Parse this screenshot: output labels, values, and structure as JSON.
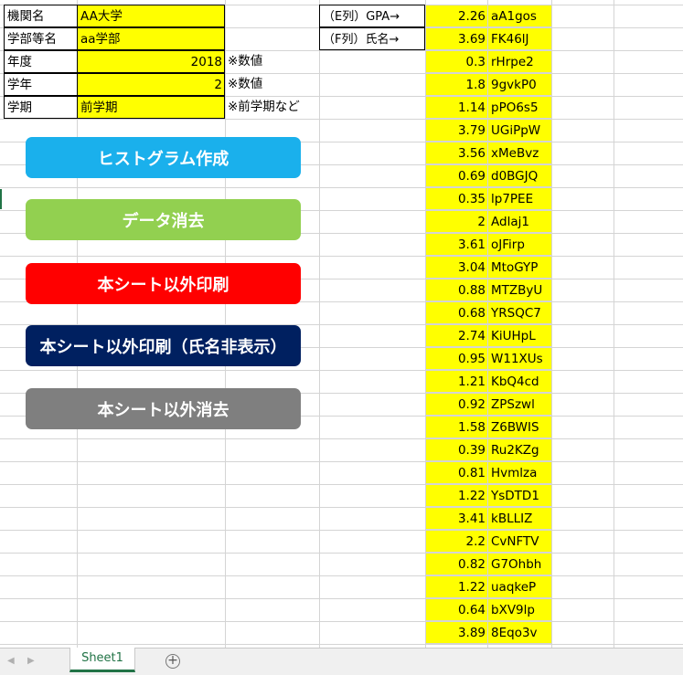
{
  "info": {
    "institution_label": "機関名",
    "institution_value": "AA大学",
    "faculty_label": "学部等名",
    "faculty_value": "aa学部",
    "year_label": "年度",
    "year_value": "2018",
    "year_note": "※数値",
    "grade_label": "学年",
    "grade_value": "2",
    "grade_note": "※数値",
    "term_label": "学期",
    "term_value": "前学期",
    "term_note": "※前学期など"
  },
  "column_hints": {
    "gpa_col": "（E列）GPA→",
    "name_col": "（F列）氏名→"
  },
  "buttons": {
    "histogram": {
      "label": "ヒストグラム作成",
      "color": "#1ab0ec"
    },
    "clear_data": {
      "label": "データ消去",
      "color": "#92d050"
    },
    "print_others": {
      "label": "本シート以外印刷",
      "color": "#ff0000"
    },
    "print_others_hidden": {
      "label": "本シート以外印刷（氏名非表示）",
      "color": "#002060"
    },
    "delete_others": {
      "label": "本シート以外消去",
      "color": "#7f7f7f"
    }
  },
  "gpa_rows": [
    {
      "gpa": "2.26",
      "name": "aA1gos"
    },
    {
      "gpa": "3.69",
      "name": "FK46lJ"
    },
    {
      "gpa": "0.3",
      "name": "rHrpe2"
    },
    {
      "gpa": "1.8",
      "name": "9gvkP0"
    },
    {
      "gpa": "1.14",
      "name": "pPO6s5"
    },
    {
      "gpa": "3.79",
      "name": "UGiPpW"
    },
    {
      "gpa": "3.56",
      "name": "xMeBvz"
    },
    {
      "gpa": "0.69",
      "name": "d0BGJQ"
    },
    {
      "gpa": "0.35",
      "name": "lp7PEE"
    },
    {
      "gpa": "2",
      "name": "Adlaj1"
    },
    {
      "gpa": "3.61",
      "name": "oJFirp"
    },
    {
      "gpa": "3.04",
      "name": "MtoGYP"
    },
    {
      "gpa": "0.88",
      "name": "MTZByU"
    },
    {
      "gpa": "0.68",
      "name": "YRSQC7"
    },
    {
      "gpa": "2.74",
      "name": "KiUHpL"
    },
    {
      "gpa": "0.95",
      "name": "W11XUs"
    },
    {
      "gpa": "1.21",
      "name": "KbQ4cd"
    },
    {
      "gpa": "0.92",
      "name": "ZPSzwl"
    },
    {
      "gpa": "1.58",
      "name": "Z6BWIS"
    },
    {
      "gpa": "0.39",
      "name": "Ru2KZg"
    },
    {
      "gpa": "0.81",
      "name": "Hvmlza"
    },
    {
      "gpa": "1.22",
      "name": "YsDTD1"
    },
    {
      "gpa": "3.41",
      "name": "kBLLIZ"
    },
    {
      "gpa": "2.2",
      "name": "CvNFTV"
    },
    {
      "gpa": "0.82",
      "name": "G7Ohbh"
    },
    {
      "gpa": "1.22",
      "name": "uaqkeP"
    },
    {
      "gpa": "0.64",
      "name": "bXV9lp"
    },
    {
      "gpa": "3.89",
      "name": "8Eqo3v"
    }
  ],
  "tabs": {
    "sheet1": "Sheet1",
    "add_icon": "plus-circle-icon"
  }
}
